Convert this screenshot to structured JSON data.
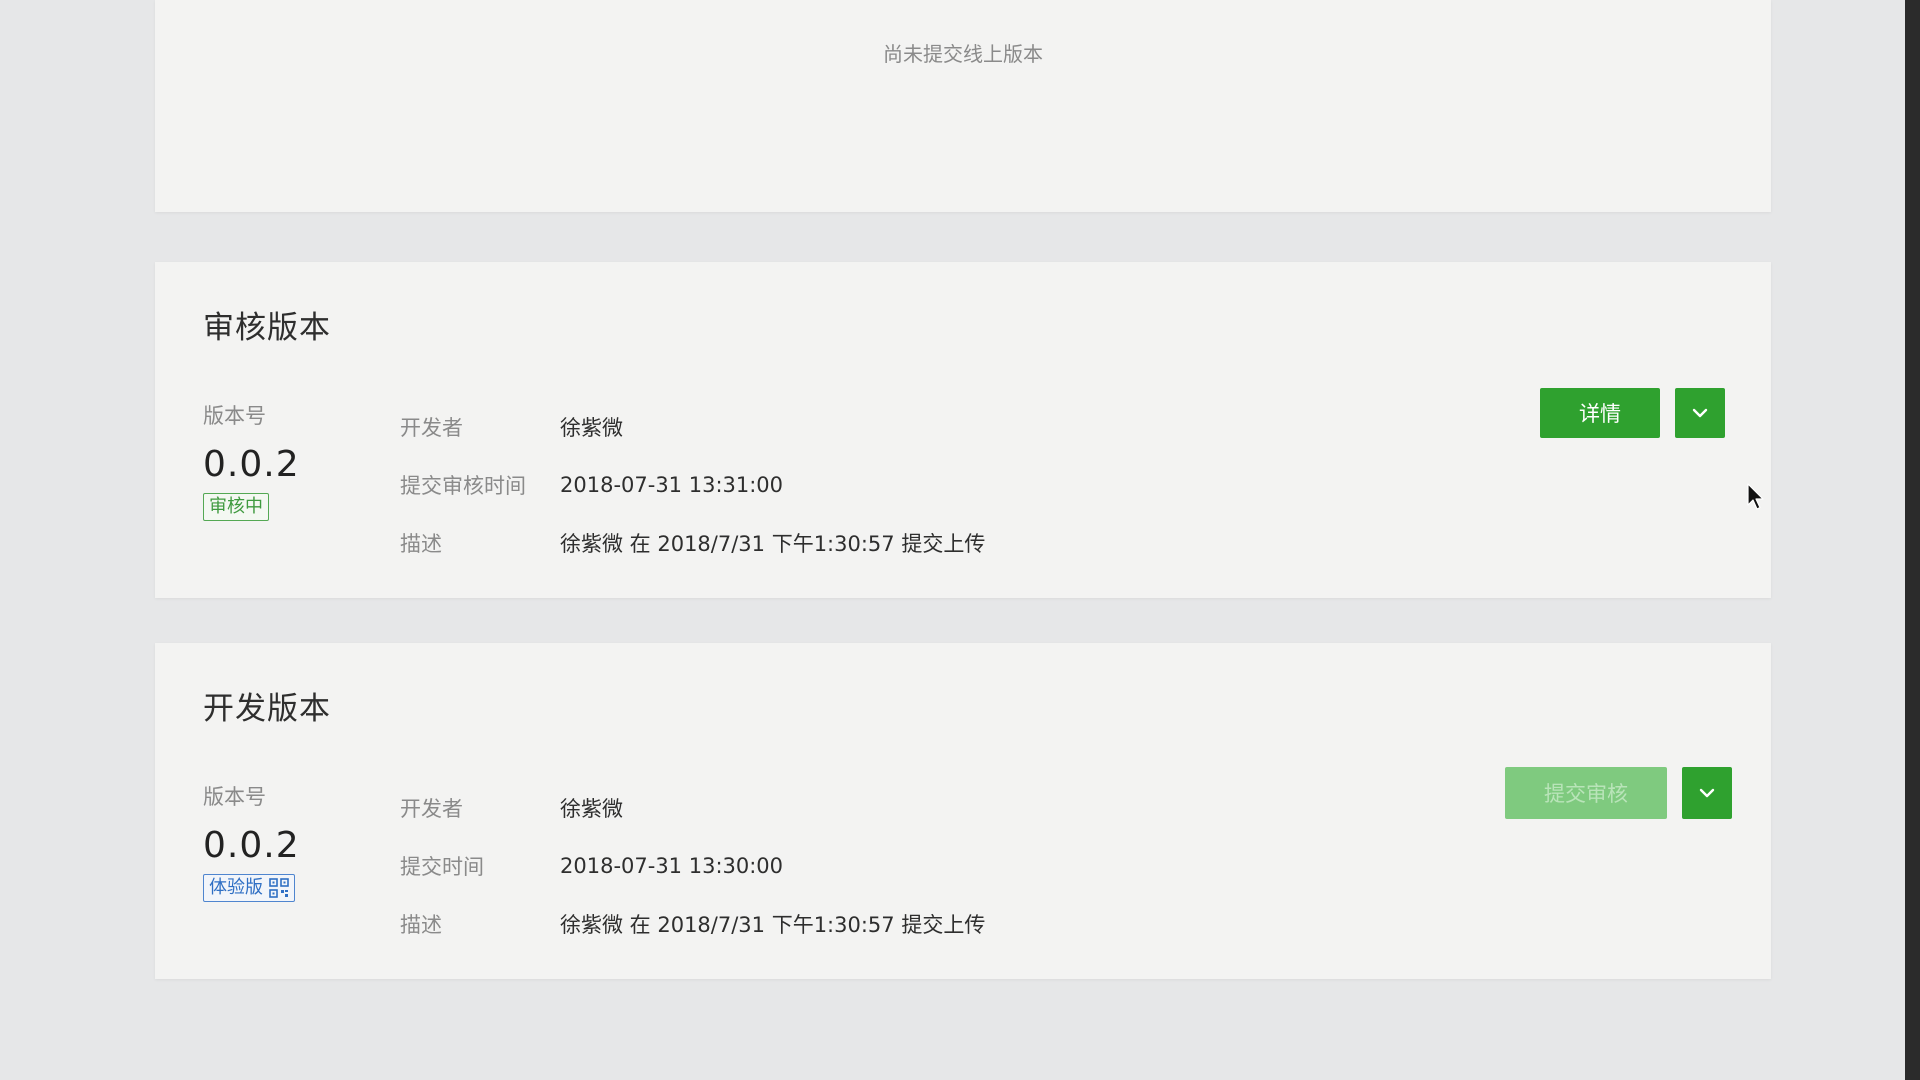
{
  "online_section": {
    "empty_note": "尚未提交线上版本"
  },
  "review_section": {
    "title": "审核版本",
    "version_label": "版本号",
    "version": "0.0.2",
    "badge": "审核中",
    "fields": [
      {
        "label": "开发者",
        "value": "徐紫微"
      },
      {
        "label": "提交审核时间",
        "value": "2018-07-31 13:31:00"
      },
      {
        "label": "描述",
        "value": "徐紫微 在 2018/7/31 下午1:30:57 提交上传"
      }
    ],
    "primary_button": "详情"
  },
  "dev_section": {
    "title": "开发版本",
    "version_label": "版本号",
    "version": "0.0.2",
    "badge": "体验版",
    "fields": [
      {
        "label": "开发者",
        "value": "徐紫微"
      },
      {
        "label": "提交时间",
        "value": "2018-07-31 13:30:00"
      },
      {
        "label": "描述",
        "value": "徐紫微 在 2018/7/31 下午1:30:57 提交上传"
      }
    ],
    "primary_button": "提交审核"
  },
  "colors": {
    "primary_green": "#2fa12f",
    "disabled_green": "#7fca7f",
    "badge_green": "#3f9a3f",
    "badge_blue": "#2f6fc4"
  },
  "icons": {
    "dropdown": "chevron-down-icon",
    "qr": "qr-code-icon",
    "cursor": "mouse-pointer-icon"
  }
}
